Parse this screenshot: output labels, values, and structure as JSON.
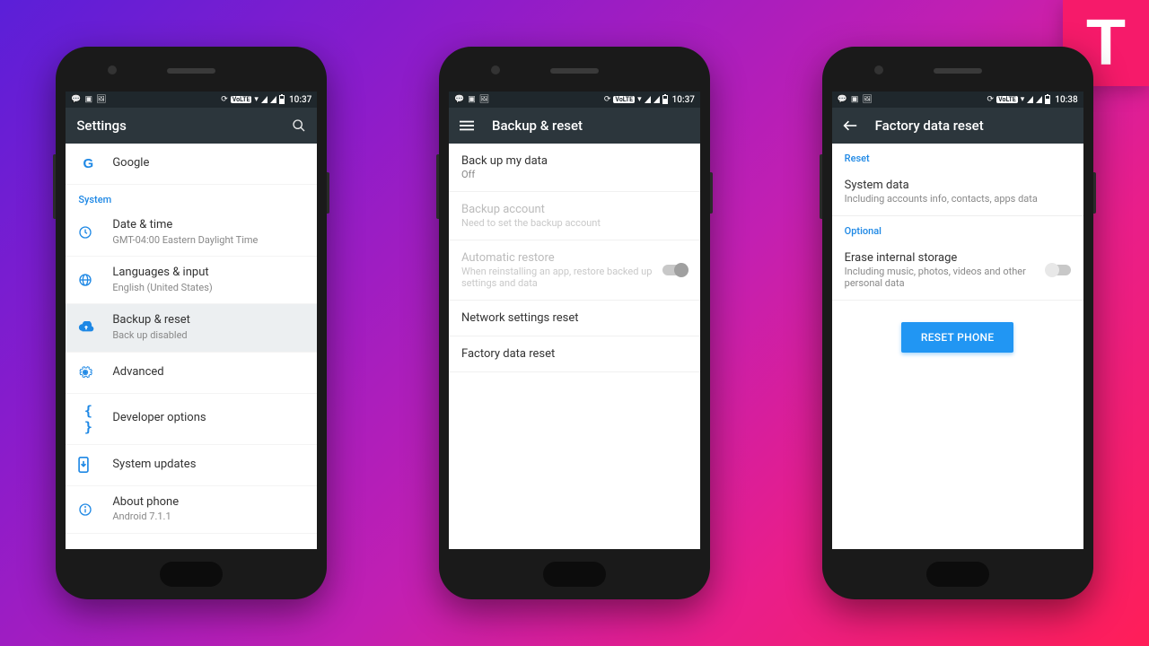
{
  "logo_text": "T",
  "status": {
    "time1": "10:37",
    "time2": "10:37",
    "time3": "10:38",
    "volte": "VoLTE"
  },
  "phone1": {
    "title": "Settings",
    "google": "Google",
    "section_system": "System",
    "date": {
      "t": "Date & time",
      "s": "GMT-04:00 Eastern Daylight Time"
    },
    "lang": {
      "t": "Languages & input",
      "s": "English (United States)"
    },
    "backup": {
      "t": "Backup & reset",
      "s": "Back up disabled"
    },
    "advanced": "Advanced",
    "dev": "Developer options",
    "updates": "System updates",
    "about": {
      "t": "About phone",
      "s": "Android 7.1.1"
    }
  },
  "phone2": {
    "title": "Backup & reset",
    "r1": {
      "t": "Back up my data",
      "s": "Off"
    },
    "r2": {
      "t": "Backup account",
      "s": "Need to set the backup account"
    },
    "r3": {
      "t": "Automatic restore",
      "s": "When reinstalling an app, restore backed up settings and data"
    },
    "r4": "Network settings reset",
    "r5": "Factory data reset"
  },
  "phone3": {
    "title": "Factory data reset",
    "section_reset": "Reset",
    "sys": {
      "t": "System data",
      "s": "Including accounts info, contacts, apps data"
    },
    "section_optional": "Optional",
    "erase": {
      "t": "Erase internal storage",
      "s": "Including music, photos, videos and other personal data"
    },
    "button": "RESET PHONE"
  }
}
